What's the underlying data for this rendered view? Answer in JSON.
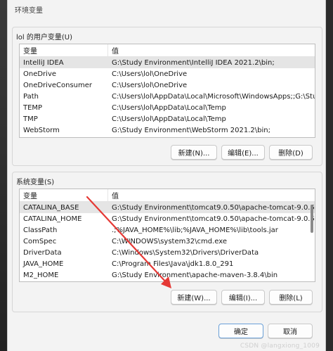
{
  "window": {
    "title": "环境变量"
  },
  "user_vars": {
    "label": "lol 的用户变量(U)",
    "col_name": "变量",
    "col_value": "值",
    "rows": [
      {
        "name": "IntelliJ IDEA",
        "value": "G:\\Study Environment\\IntelliJ IDEA 2021.2\\bin;"
      },
      {
        "name": "OneDrive",
        "value": "C:\\Users\\lol\\OneDrive"
      },
      {
        "name": "OneDriveConsumer",
        "value": "C:\\Users\\lol\\OneDrive"
      },
      {
        "name": "Path",
        "value": "C:\\Users\\lol\\AppData\\Local\\Microsoft\\WindowsApps;;G:\\Stud..."
      },
      {
        "name": "TEMP",
        "value": "C:\\Users\\lol\\AppData\\Local\\Temp"
      },
      {
        "name": "TMP",
        "value": "C:\\Users\\lol\\AppData\\Local\\Temp"
      },
      {
        "name": "WebStorm",
        "value": "G:\\Study Environment\\WebStorm 2021.2\\bin;"
      }
    ],
    "buttons": {
      "new": "新建(N)...",
      "edit": "编辑(E)...",
      "delete": "删除(D)"
    }
  },
  "system_vars": {
    "label": "系统变量(S)",
    "col_name": "变量",
    "col_value": "值",
    "rows": [
      {
        "name": "CATALINA_BASE",
        "value": "G:\\Study Environment\\tomcat9.0.50\\apache-tomcat-9.0.50-wi..."
      },
      {
        "name": "CATALINA_HOME",
        "value": "G:\\Study Environment\\tomcat9.0.50\\apache-tomcat-9.0.50-wi..."
      },
      {
        "name": "ClassPath",
        "value": ".;%JAVA_HOME%\\lib;%JAVA_HOME%\\lib\\tools.jar"
      },
      {
        "name": "ComSpec",
        "value": "C:\\WINDOWS\\system32\\cmd.exe"
      },
      {
        "name": "DriverData",
        "value": "C:\\Windows\\System32\\Drivers\\DriverData"
      },
      {
        "name": "JAVA_HOME",
        "value": "C:\\Program Files\\Java\\jdk1.8.0_291"
      },
      {
        "name": "M2_HOME",
        "value": "G:\\Study Environment\\apache-maven-3.8.4\\bin"
      }
    ],
    "buttons": {
      "new": "新建(W)...",
      "edit": "编辑(I)...",
      "delete": "删除(L)"
    }
  },
  "footer": {
    "ok": "确定",
    "cancel": "取消"
  },
  "watermark": "CSDN @langxiong_1009",
  "colors": {
    "annotation_arrow": "#e53935",
    "selected_row": "#e5e5e5"
  }
}
